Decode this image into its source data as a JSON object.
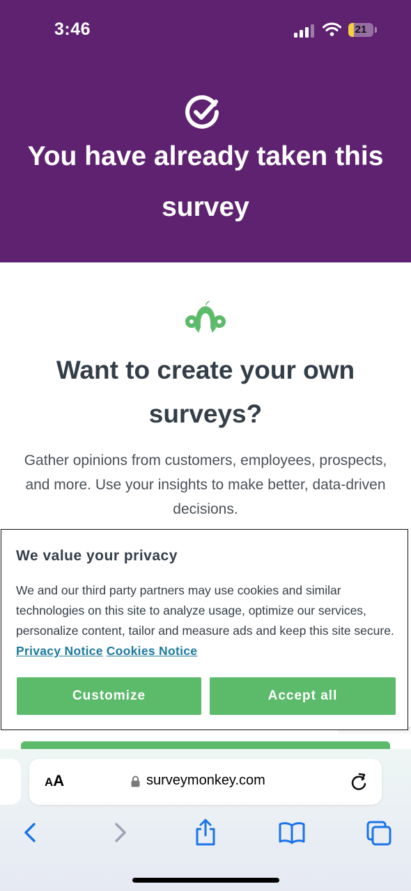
{
  "status_bar": {
    "time": "3:46",
    "battery_level": "21",
    "battery_fraction": 0.21
  },
  "hero": {
    "title": "You have already taken this survey",
    "icon": "check-circle-icon",
    "background": "#5f2270"
  },
  "promo": {
    "logo": "surveymonkey-logo-icon",
    "title": "Want to create your own surveys?",
    "description": "Gather opinions from customers, employees, prospects, and more. Use your insights to make better, data-driven decisions."
  },
  "cookie_banner": {
    "title": "We value your privacy",
    "text": "We and our third party partners may use cookies and similar technologies on this site to analyze usage, optimize our services, personalize content, tailor and measure ads and keep this site secure.",
    "privacy_link": "Privacy Notice",
    "cookies_link": "Cookies Notice",
    "customize_label": "Customize",
    "accept_label": "Accept all",
    "button_color": "#5cba6b",
    "link_color": "#1d7a9c"
  },
  "browser": {
    "text_size_label_small": "A",
    "text_size_label_large": "A",
    "url": "surveymonkey.com",
    "icons": [
      "back-icon",
      "forward-icon",
      "share-icon",
      "bookmarks-icon",
      "tabs-icon"
    ]
  }
}
